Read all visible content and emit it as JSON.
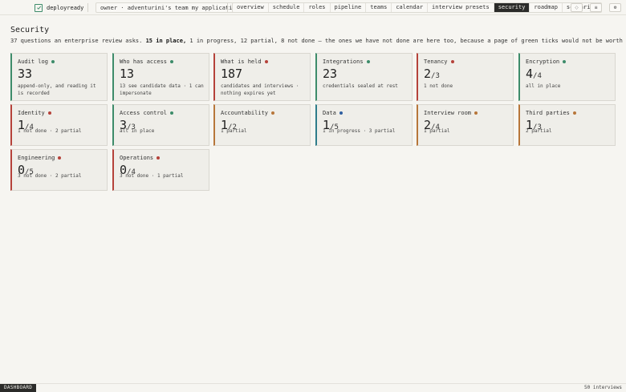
{
  "brand": {
    "name": "deployready"
  },
  "owner": {
    "label": "owner · adventurini's team my applications"
  },
  "nav": [
    {
      "label": "overview"
    },
    {
      "label": "schedule"
    },
    {
      "label": "roles"
    },
    {
      "label": "pipeline"
    },
    {
      "label": "teams"
    },
    {
      "label": "calendar"
    },
    {
      "label": "interview presets"
    },
    {
      "label": "security"
    },
    {
      "label": "roadmap"
    },
    {
      "label": "scenarios"
    }
  ],
  "active_nav": "security",
  "tools": {
    "theme_glyph": "◌",
    "menu_glyph": "≡",
    "settings_glyph": "⚙"
  },
  "page": {
    "title": "Security",
    "summary_pre": "37 questions an enterprise review asks.",
    "summary_bold": "15 in place,",
    "summary_post": "1 in progress, 12 partial, 8 not done — the ones we have not done are here too, because a page of green ticks would not be worth reading."
  },
  "colors": {
    "green": "#3d8c6a",
    "red": "#b5423a",
    "blue": "#2f5fa0",
    "orange": "#b7763a",
    "blue_border": "#2f7d8a"
  },
  "cards": [
    {
      "title": "Audit log",
      "status": "green",
      "value": "33",
      "denom": "",
      "desc": "append-only, and reading it is recorded"
    },
    {
      "title": "Who has access",
      "status": "green",
      "value": "13",
      "denom": "",
      "desc": "13 see candidate data · 1 can impersonate"
    },
    {
      "title": "What is held",
      "status": "red",
      "value": "187",
      "denom": "",
      "desc": "candidates and interviews · nothing expires yet"
    },
    {
      "title": "Integrations",
      "status": "green",
      "value": "23",
      "denom": "",
      "desc": "credentials sealed at rest"
    },
    {
      "title": "Tenancy",
      "status": "red",
      "value": "2",
      "denom": "/3",
      "desc": "1 not done"
    },
    {
      "title": "Encryption",
      "status": "green",
      "value": "4",
      "denom": "/4",
      "desc": "all in place"
    },
    {
      "title": "Identity",
      "status": "red",
      "value": "1",
      "denom": "/4",
      "desc": "1 not done · 2 partial"
    },
    {
      "title": "Access control",
      "status": "green",
      "value": "3",
      "denom": "/3",
      "desc": "all in place"
    },
    {
      "title": "Accountability",
      "status": "orange",
      "value": "1",
      "denom": "/2",
      "desc": "1 partial"
    },
    {
      "title": "Data",
      "status": "blue",
      "value": "1",
      "denom": "/5",
      "desc": "1 in progress · 3 partial"
    },
    {
      "title": "Interview room",
      "status": "orange",
      "value": "2",
      "denom": "/4",
      "desc": "1 partial"
    },
    {
      "title": "Third parties",
      "status": "orange",
      "value": "1",
      "denom": "/3",
      "desc": "2 partial"
    },
    {
      "title": "Engineering",
      "status": "red",
      "value": "0",
      "denom": "/5",
      "desc": "3 not done · 2 partial"
    },
    {
      "title": "Operations",
      "status": "red",
      "value": "0",
      "denom": "/4",
      "desc": "3 not done · 1 partial"
    }
  ],
  "footer": {
    "tab": "DASHBOARD",
    "count": "50 interviews"
  }
}
